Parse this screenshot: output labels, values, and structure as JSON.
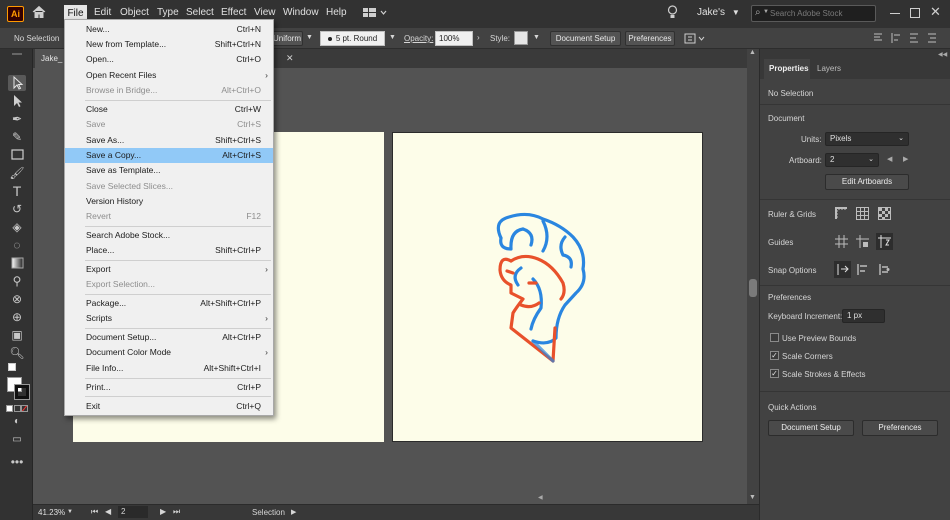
{
  "menubar": {
    "logo": "Ai",
    "items": [
      "File",
      "Edit",
      "Object",
      "Type",
      "Select",
      "Effect",
      "View",
      "Window",
      "Help"
    ],
    "user": "Jake's",
    "search_placeholder": "Search Adobe Stock"
  },
  "control": {
    "selection": "No Selection",
    "uniform": "Uniform",
    "brush": "5 pt. Round",
    "opacity_label": "Opacity:",
    "opacity_value": "100%",
    "style_label": "Style:",
    "document_setup": "Document Setup",
    "preferences": "Preferences"
  },
  "doc_tab": "Jake_",
  "file_menu": [
    {
      "label": "New...",
      "shortcut": "Ctrl+N",
      "disabled": false
    },
    {
      "label": "New from Template...",
      "shortcut": "Shift+Ctrl+N",
      "disabled": false
    },
    {
      "label": "Open...",
      "shortcut": "Ctrl+O",
      "disabled": false
    },
    {
      "label": "Open Recent Files",
      "shortcut": "",
      "submenu": true,
      "disabled": false
    },
    {
      "label": "Browse in Bridge...",
      "shortcut": "Alt+Ctrl+O",
      "disabled": true
    },
    {
      "label": "Close",
      "shortcut": "Ctrl+W",
      "disabled": false
    },
    {
      "label": "Save",
      "shortcut": "Ctrl+S",
      "disabled": true
    },
    {
      "label": "Save As...",
      "shortcut": "Shift+Ctrl+S",
      "disabled": false
    },
    {
      "label": "Save a Copy...",
      "shortcut": "Alt+Ctrl+S",
      "disabled": false,
      "highlighted": true
    },
    {
      "label": "Save as Template...",
      "shortcut": "",
      "disabled": false
    },
    {
      "label": "Save Selected Slices...",
      "shortcut": "",
      "disabled": true
    },
    {
      "label": "Version History",
      "shortcut": "",
      "disabled": false
    },
    {
      "label": "Revert",
      "shortcut": "F12",
      "disabled": true
    },
    {
      "label": "Search Adobe Stock...",
      "shortcut": "",
      "disabled": false
    },
    {
      "label": "Place...",
      "shortcut": "Shift+Ctrl+P",
      "disabled": false
    },
    {
      "label": "Export",
      "shortcut": "",
      "submenu": true,
      "disabled": false
    },
    {
      "label": "Export Selection...",
      "shortcut": "",
      "disabled": true
    },
    {
      "label": "Package...",
      "shortcut": "Alt+Shift+Ctrl+P",
      "disabled": false
    },
    {
      "label": "Scripts",
      "shortcut": "",
      "submenu": true,
      "disabled": false
    },
    {
      "label": "Document Setup...",
      "shortcut": "Alt+Ctrl+P",
      "disabled": false
    },
    {
      "label": "Document Color Mode",
      "shortcut": "",
      "submenu": true,
      "disabled": false
    },
    {
      "label": "File Info...",
      "shortcut": "Alt+Shift+Ctrl+I",
      "disabled": false
    },
    {
      "label": "Print...",
      "shortcut": "Ctrl+P",
      "disabled": false
    },
    {
      "label": "Exit",
      "shortcut": "Ctrl+Q",
      "disabled": false
    }
  ],
  "panel": {
    "tabs": [
      "Properties",
      "Layers"
    ],
    "no_selection": "No Selection",
    "document": "Document",
    "units_label": "Units:",
    "units_value": "Pixels",
    "artboard_label": "Artboard:",
    "artboard_value": "2",
    "edit_artboards": "Edit Artboards",
    "ruler_grids": "Ruler & Grids",
    "guides": "Guides",
    "snap_options": "Snap Options",
    "preferences": "Preferences",
    "keyboard_increment_label": "Keyboard Increment:",
    "keyboard_increment_value": "1 px",
    "use_preview_bounds": "Use Preview Bounds",
    "scale_corners": "Scale Corners",
    "scale_strokes": "Scale Strokes & Effects",
    "quick_actions": "Quick Actions",
    "document_setup_btn": "Document Setup",
    "preferences_btn": "Preferences"
  },
  "status": {
    "zoom": "41.23%",
    "artboard": "2",
    "tool": "Selection"
  },
  "colors": {
    "accent_red": "#e8512b",
    "accent_blue": "#2a86e0",
    "artboard": "#fdfde9",
    "menu_highlight": "#91c9f7"
  }
}
